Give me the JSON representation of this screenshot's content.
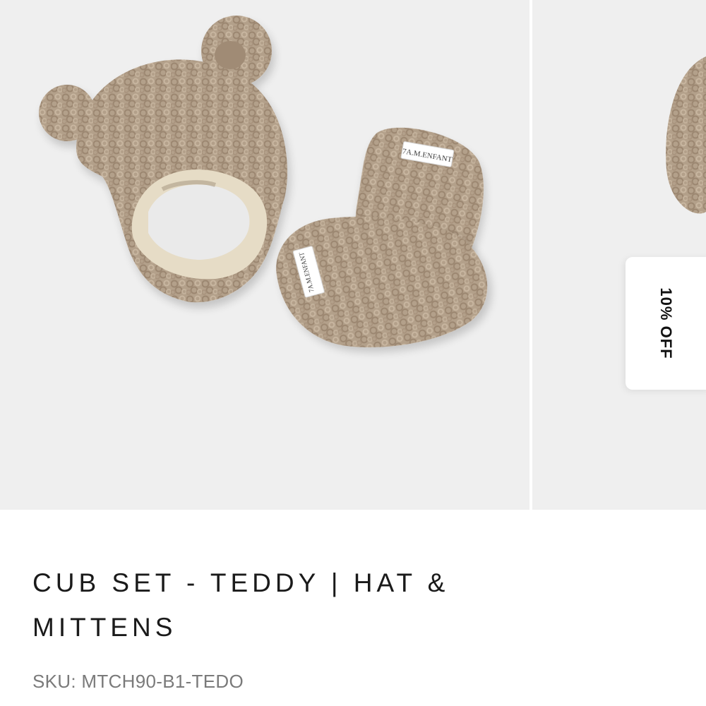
{
  "gallery": {
    "images": [
      {
        "name": "teddy-hat-and-mittens-photo"
      },
      {
        "name": "teddy-hat-partial-photo"
      }
    ],
    "mitten_tag_text": "7A.M.ENFANT"
  },
  "badge": {
    "discount_label": "10% OFF"
  },
  "product": {
    "title": "CUB SET - TEDDY | HAT & MITTENS",
    "sku_label": "SKU:",
    "sku_value": "MTCH90-B1-TEDO"
  },
  "colors": {
    "photo_background": "#efefef",
    "teddy_fleece": "#b3a08a",
    "hat_lining": "#e6dcc6",
    "title_text": "#1a1a1a",
    "sku_text": "#7a7a7a"
  }
}
